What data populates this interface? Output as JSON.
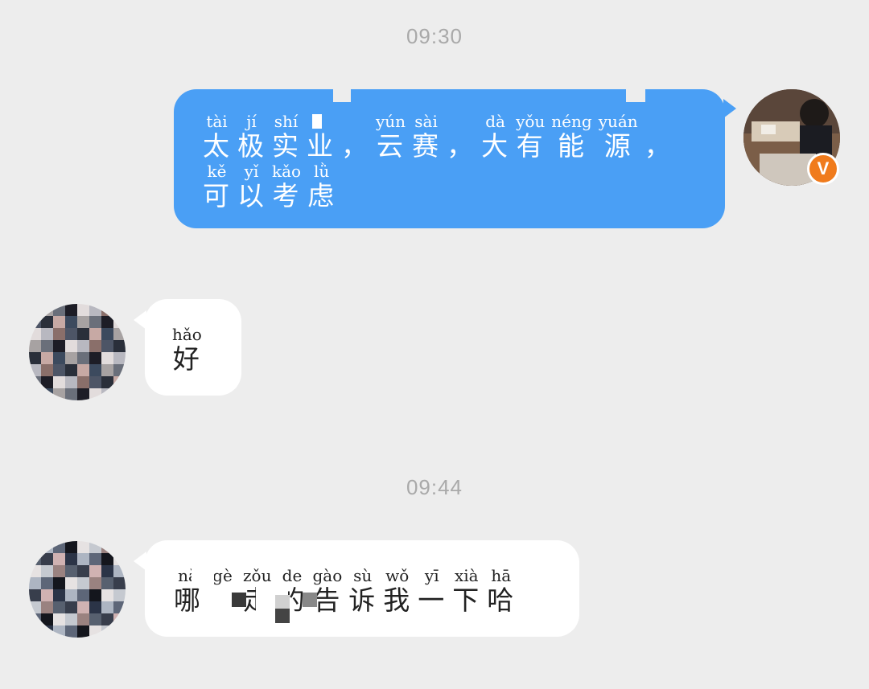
{
  "timestamps": [
    "09:30",
    "09:44"
  ],
  "messages": [
    {
      "side": "sent",
      "lines": [
        [
          {
            "py": "tài",
            "hz": "太"
          },
          {
            "py": "jí",
            "hz": "极"
          },
          {
            "py": "shí",
            "hz": "实"
          },
          {
            "py": "",
            "hz": "业"
          },
          {
            "py": "",
            "hz": "，"
          },
          {
            "py": "yún",
            "hz": "云"
          },
          {
            "py": "sài",
            "hz": "赛"
          },
          {
            "py": "",
            "hz": "，"
          },
          {
            "py": "dà",
            "hz": "大"
          },
          {
            "py": "yǒu",
            "hz": "有"
          },
          {
            "py": "néng",
            "hz": "能"
          },
          {
            "py": "yuán",
            "hz": "源"
          },
          {
            "py": "",
            "hz": "，"
          }
        ],
        [
          {
            "py": "kě",
            "hz": "可"
          },
          {
            "py": "yǐ",
            "hz": "以"
          },
          {
            "py": "kǎo",
            "hz": "考"
          },
          {
            "py": "lǜ",
            "hz": "虑"
          }
        ]
      ]
    },
    {
      "side": "recv",
      "lines": [
        [
          {
            "py": "hǎo",
            "hz": "好"
          }
        ]
      ]
    },
    {
      "side": "recv",
      "lines": [
        [
          {
            "py": "nǎ",
            "hz": "哪"
          },
          {
            "py": "gè",
            "hz": "个"
          },
          {
            "py": "zǒu",
            "hz": "走"
          },
          {
            "py": "de",
            "hz": "的"
          },
          {
            "py": "gào",
            "hz": "告"
          },
          {
            "py": "sù",
            "hz": "诉"
          },
          {
            "py": "wǒ",
            "hz": "我"
          },
          {
            "py": "yī",
            "hz": "一"
          },
          {
            "py": "xià",
            "hz": "下"
          },
          {
            "py": "hā",
            "hz": "哈"
          }
        ]
      ]
    }
  ],
  "badge": {
    "label": "V"
  },
  "colors": {
    "background": "#ededed",
    "sent_bubble": "#4a9ff5",
    "recv_bubble": "#ffffff",
    "badge": "#f07b1c",
    "timestamp": "#a9a9a9"
  },
  "icons": {
    "self_avatar": "user-photo-avatar",
    "contact_avatar": "pixelated-avatar",
    "verified_badge": "verified-v-badge"
  }
}
